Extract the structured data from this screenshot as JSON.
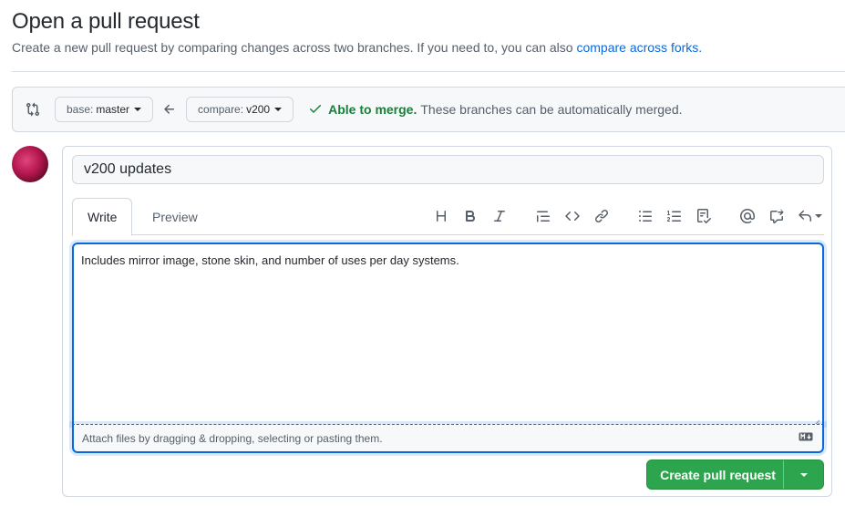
{
  "header": {
    "title": "Open a pull request",
    "subtitle": "Create a new pull request by comparing changes across two branches. If you need to, you can also ",
    "forks_link": "compare across forks."
  },
  "range": {
    "icon": "git-compare-icon",
    "base_label": "base:",
    "base_branch": "master",
    "arrow_icon": "arrow-left-icon",
    "compare_label": "compare:",
    "compare_branch": "v200",
    "merge_icon": "check-icon",
    "merge_ok": "Able to merge.",
    "merge_msg": "These branches can be automatically merged."
  },
  "composer": {
    "title_value": "v200 updates",
    "tabs": [
      {
        "label": "Write"
      },
      {
        "label": "Preview"
      }
    ],
    "toolbar": {
      "heading": "H",
      "icons": [
        "heading-icon",
        "bold-icon",
        "italic-icon",
        "quote-icon",
        "code-icon",
        "link-icon",
        "unordered-list-icon",
        "ordered-list-icon",
        "tasklist-icon",
        "mention-icon",
        "cross-reference-icon",
        "reply-icon"
      ]
    },
    "body_value": "Includes mirror image, stone skin, and number of uses per day systems.",
    "attach_text": "Attach files by dragging & dropping, selecting or pasting them.",
    "submit_label": "Create pull request"
  },
  "colors": {
    "accent": "#0969da",
    "success": "#2da44e",
    "success_text": "#1a7f37"
  }
}
